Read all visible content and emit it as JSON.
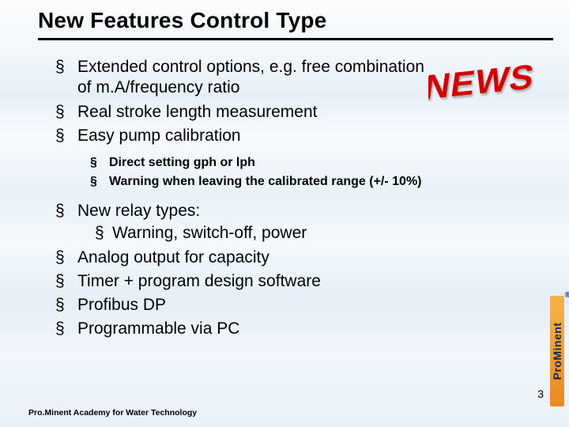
{
  "title": "New Features Control Type",
  "newsBadge": "NEWS",
  "bullets": {
    "top": [
      "Extended control options, e.g. free combination of m.A/frequency ratio",
      "Real stroke length measurement",
      "Easy pump calibration"
    ],
    "sub": [
      "Direct setting gph or lph",
      "Warning when leaving the calibrated range (+/- 10%)"
    ],
    "mid_first": "New relay types:",
    "mid_first_nested": [
      "Warning, switch-off, power"
    ],
    "mid_rest": [
      "Analog output for capacity",
      "Timer + program design software",
      "Profibus DP",
      "Programmable via PC"
    ]
  },
  "footer": "Pro.Minent Academy for Water Technology",
  "pageNumber": "3",
  "logo": {
    "text": "ProMinent",
    "reg": "®"
  }
}
